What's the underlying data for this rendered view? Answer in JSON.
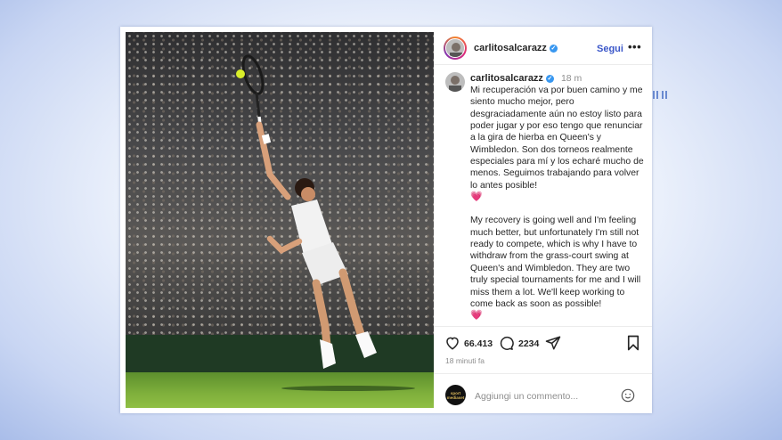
{
  "post": {
    "username": "carlitosalcarazz",
    "follow_label": "Segui",
    "more_label": "•••",
    "caption_time": "18 m",
    "caption_es": "Mi recuperación va por buen camino y me siento mucho mejor, pero desgraciadamente aún no estoy listo para poder jugar y por eso tengo que renunciar a la gira de hierba en Queen's y Wimbledon. Son dos torneos realmente especiales para mí y los echaré mucho de menos. Seguimos trabajando para volver lo antes posible!",
    "caption_en": "My recovery is going well and I'm feeling much better, but unfortunately I'm still not ready to compete, which is why I have to withdraw from the grass-court swing at Queen's and Wimbledon. They are two truly special tournaments for me and I will miss them a lot. We'll keep working to come back as soon as possible!",
    "heart_emoji": "💗",
    "likes": "66.413",
    "comments": "2234",
    "posted_ago": "18 minuti fa",
    "comment_placeholder": "Aggiungi un commento...",
    "commenter_avatar_text": "sport\nmediaset"
  },
  "icons": [
    "verified-icon",
    "more-icon",
    "heart-icon",
    "comment-icon",
    "share-icon",
    "bookmark-icon",
    "emoji-icon"
  ],
  "colors": {
    "link": "#3b57c9",
    "verified": "#3897f0",
    "heart": "#ed4956",
    "muted": "#8e8e8e"
  }
}
